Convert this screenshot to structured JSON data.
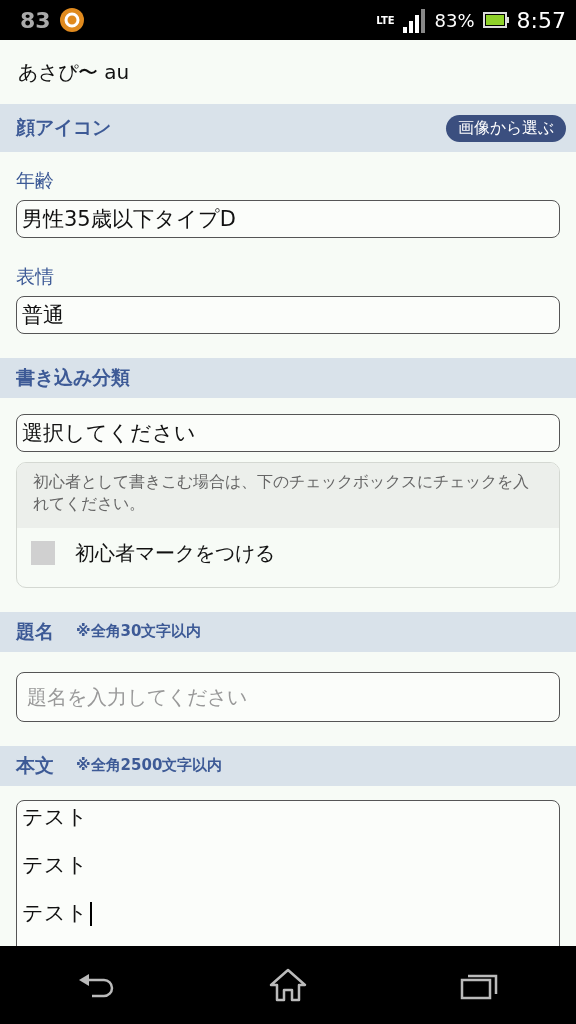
{
  "status_bar": {
    "notification_count": "83",
    "network": "LTE",
    "battery": "83%",
    "time": "8:57"
  },
  "user_line": "あさぴ〜 au",
  "sections": [
    {
      "kind": "face",
      "title": "顔アイコン",
      "button": "画像から選ぶ",
      "fields": [
        {
          "label": "年齢",
          "value": "男性35歳以下タイプD"
        },
        {
          "label": "表情",
          "value": "普通"
        }
      ]
    },
    {
      "kind": "category",
      "title": "書き込み分類",
      "select": "選択してください",
      "notice": "初心者として書きこむ場合は、下のチェックボックスにチェックを入れてください。",
      "checkbox": {
        "label": "初心者マークをつける",
        "checked": false
      }
    },
    {
      "kind": "subject",
      "title": "題名",
      "note": "※全角30文字以内",
      "placeholder": "題名を入力してください"
    },
    {
      "kind": "body",
      "title": "本文",
      "note": "※全角2500文字以内",
      "lines": [
        "テスト",
        "テスト",
        "テスト"
      ]
    }
  ]
}
